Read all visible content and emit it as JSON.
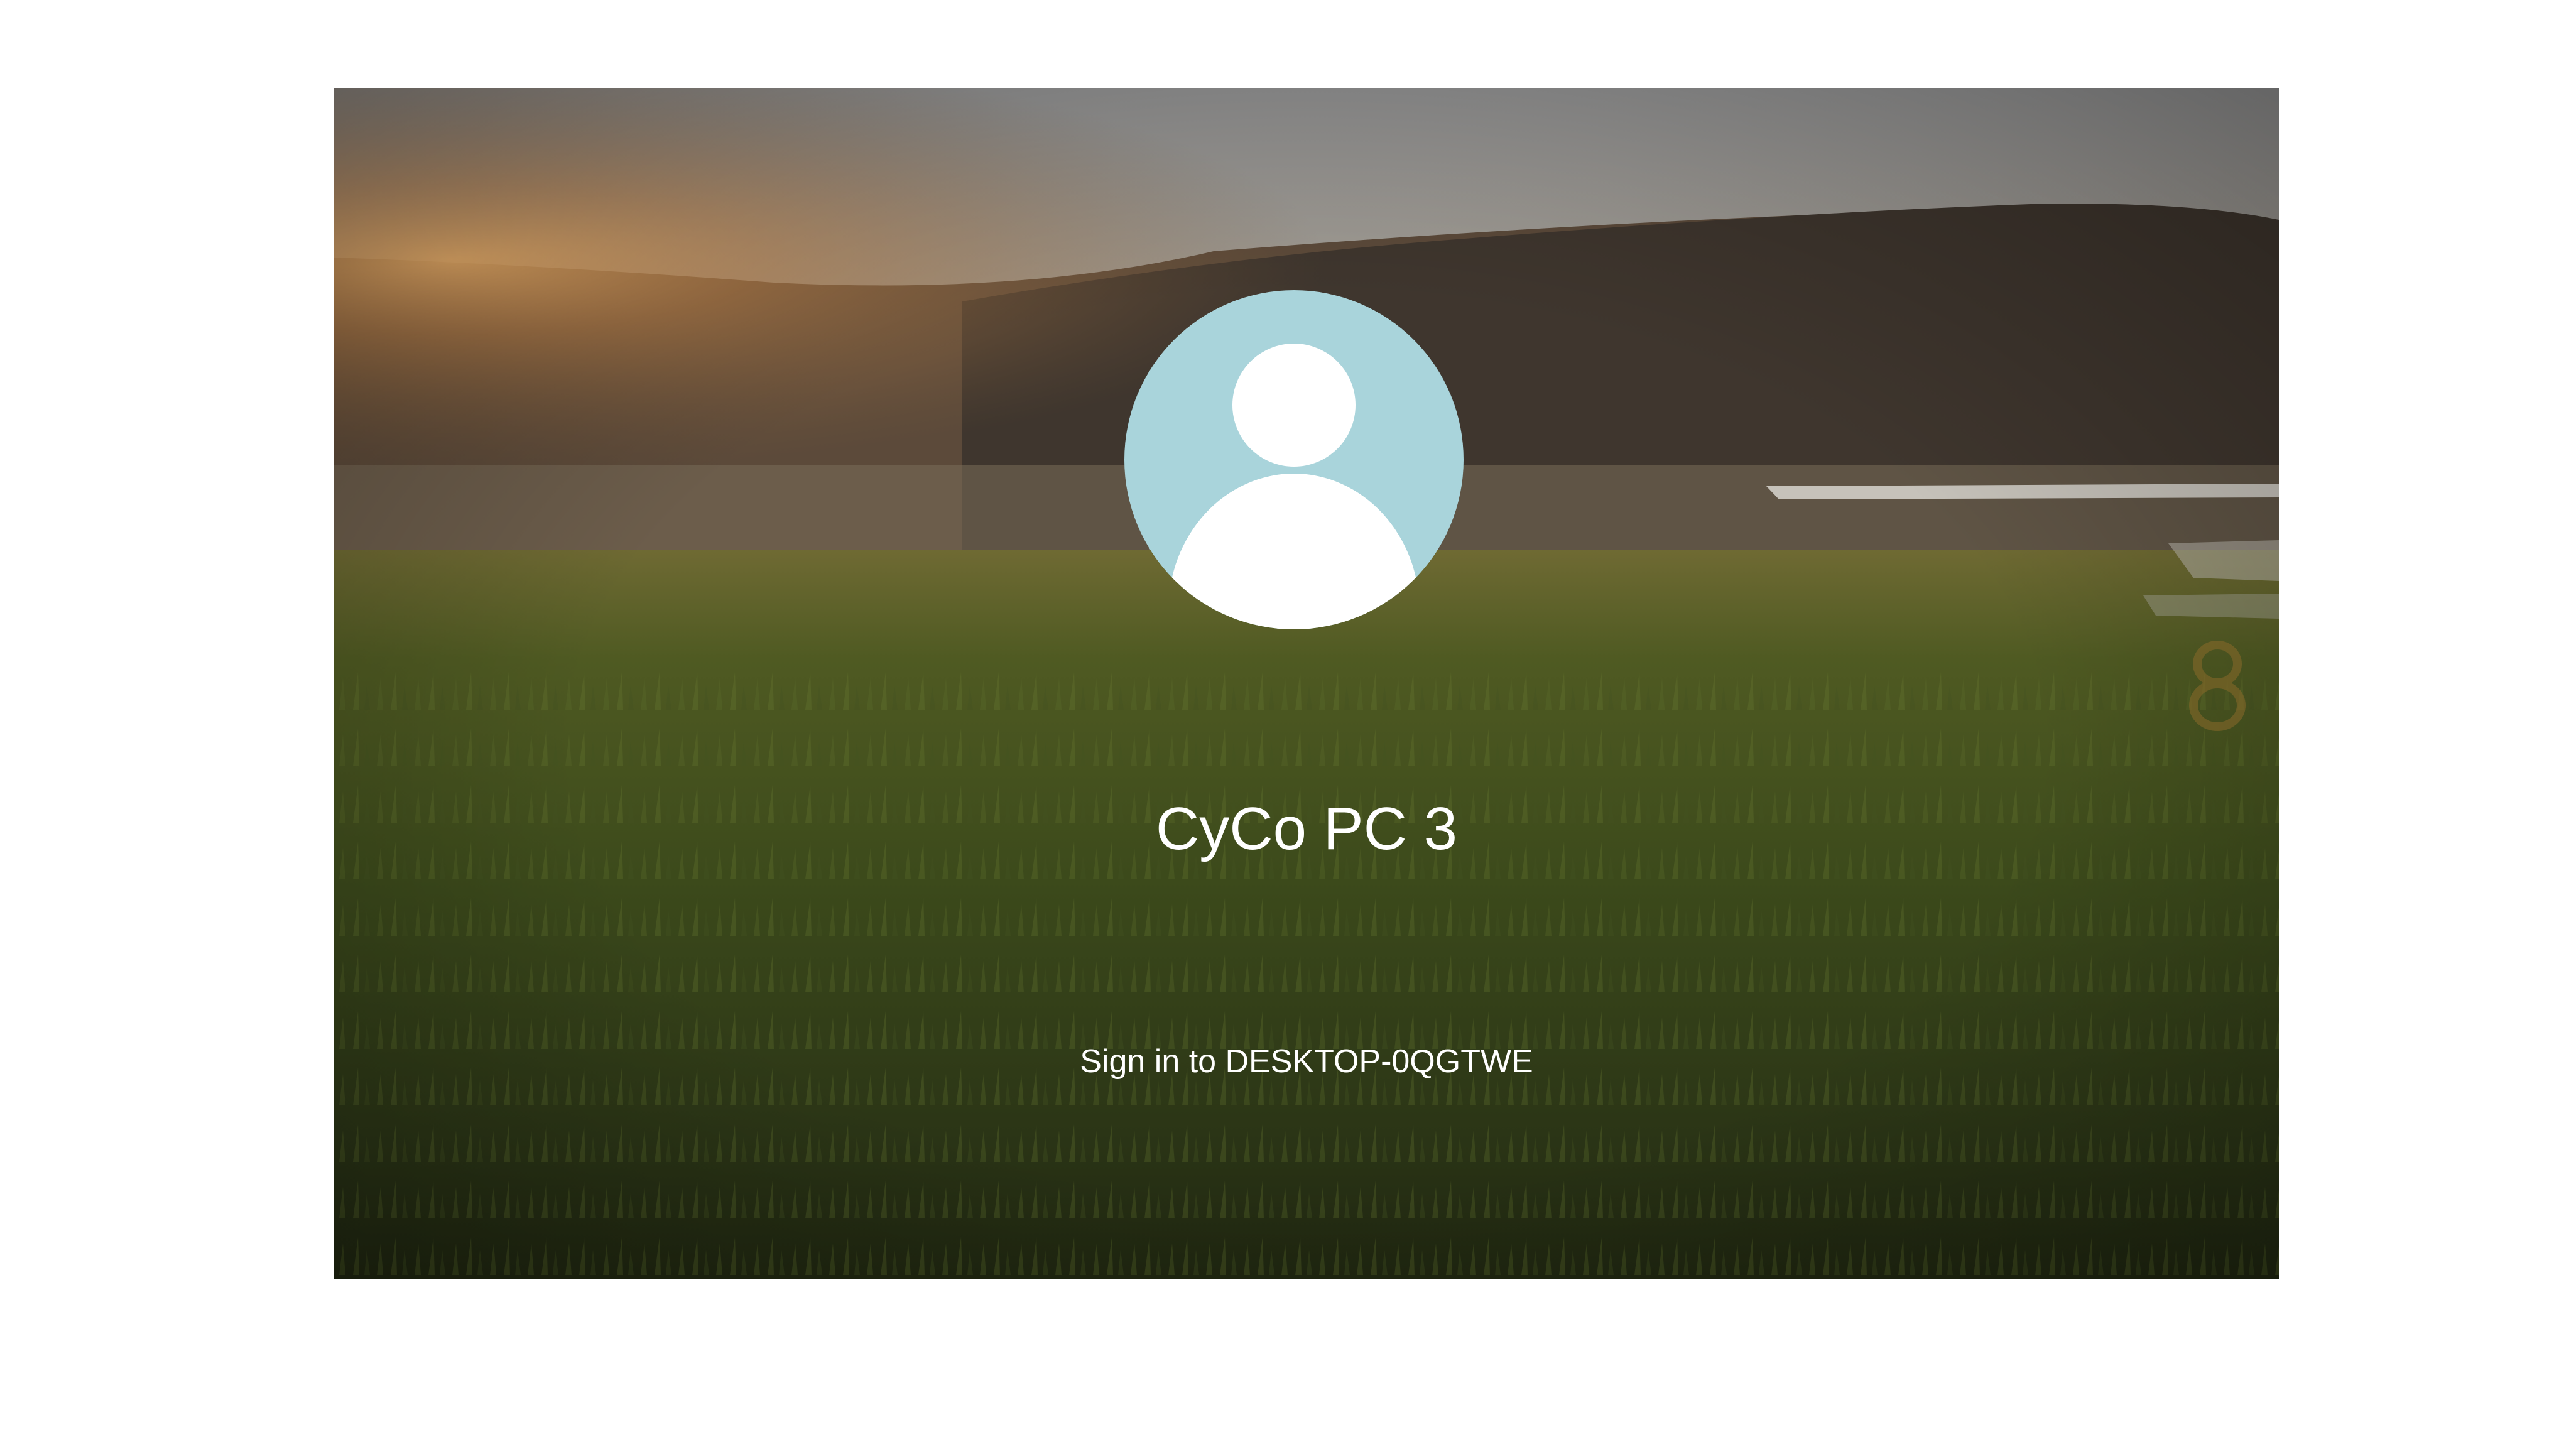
{
  "user": {
    "name": "CyCo PC 3",
    "avatar_icon": "person-silhouette-icon"
  },
  "signin": {
    "label": "Sign in to DESKTOP-0QGTWE"
  },
  "wallpaper": {
    "description_icon": "grass-field-sunset-background"
  },
  "colors": {
    "avatar_bg": "#a9d4db",
    "avatar_figure": "#ffffff",
    "text": "#ffffff"
  }
}
